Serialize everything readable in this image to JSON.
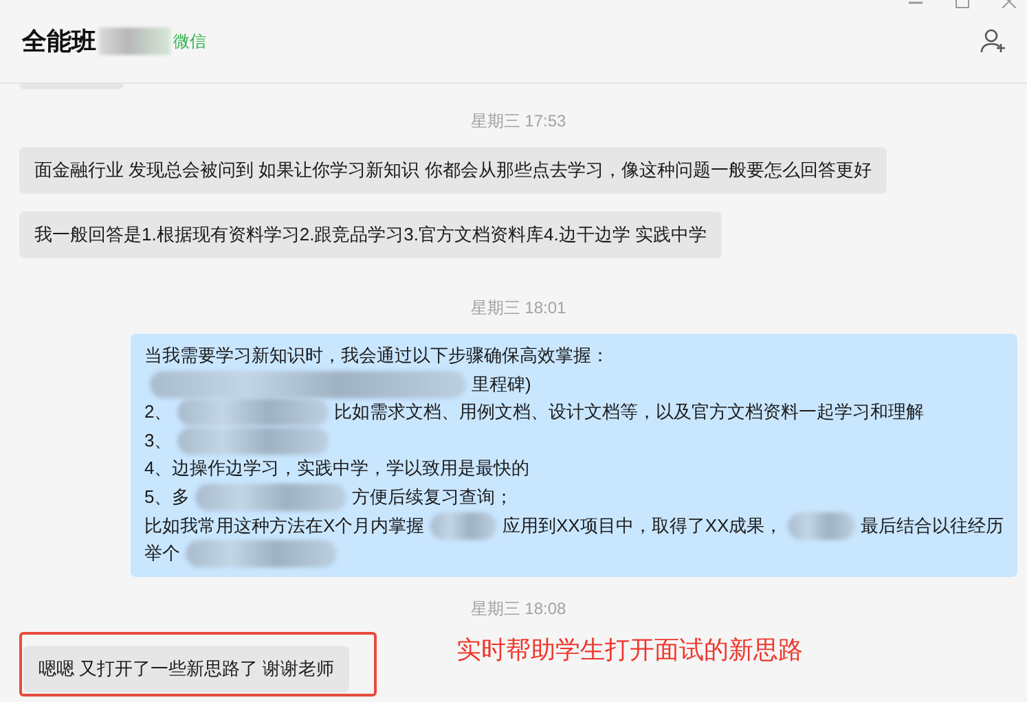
{
  "header": {
    "title": "全能班",
    "source": "微信"
  },
  "messages": [
    {
      "kind": "stub"
    },
    {
      "kind": "time",
      "text": "星期三 17:53"
    },
    {
      "kind": "received",
      "text": "面金融行业 发现总会被问到 如果让你学习新知识 你都会从那些点去学习，像这种问题一般要怎么回答更好"
    },
    {
      "kind": "received",
      "text": "我一般回答是1.根据现有资料学习2.跟竞品学习3.官方文档资料库4.边干边学 实践中学"
    },
    {
      "kind": "time",
      "text": "星期三 18:01"
    },
    {
      "kind": "sent",
      "lines": [
        {
          "segments": [
            {
              "kind": "text",
              "text": "当我需要学习新知识时，我会通过以下步骤确保高效掌握："
            }
          ]
        },
        {
          "segments": [
            {
              "kind": "blur"
            },
            {
              "kind": "text",
              "text": "里程碑)"
            }
          ]
        },
        {
          "segments": [
            {
              "kind": "text",
              "text": "2、"
            },
            {
              "kind": "blur"
            },
            {
              "kind": "text",
              "text": "比如需求文档、用例文档、设计文档等，以及官方文档资料一起学习和理解"
            }
          ]
        },
        {
          "segments": [
            {
              "kind": "text",
              "text": "3、"
            },
            {
              "kind": "blur"
            }
          ]
        },
        {
          "segments": [
            {
              "kind": "text",
              "text": "4、边操作边学习，实践中学，学以致用是最快的"
            }
          ]
        },
        {
          "segments": [
            {
              "kind": "text",
              "text": "5、多"
            },
            {
              "kind": "blur"
            },
            {
              "kind": "text",
              "text": "方便后续复习查询；"
            }
          ]
        },
        {
          "segments": [
            {
              "kind": "text",
              "text": "比如我常用这种方法在X个月内掌握"
            },
            {
              "kind": "blur"
            },
            {
              "kind": "text",
              "text": "应用到XX项目中，取得了XX成果，"
            },
            {
              "kind": "blur"
            },
            {
              "kind": "text",
              "text": "最后结合以往经历"
            }
          ]
        },
        {
          "segments": [
            {
              "kind": "text",
              "text": "举个"
            },
            {
              "kind": "blur"
            }
          ]
        }
      ]
    },
    {
      "kind": "time",
      "text": "星期三 18:08"
    },
    {
      "kind": "received",
      "text": "嗯嗯 又打开了一些新思路了 谢谢老师",
      "highlighted": true
    }
  ],
  "annotation": "实时帮助学生打开面试的新思路"
}
